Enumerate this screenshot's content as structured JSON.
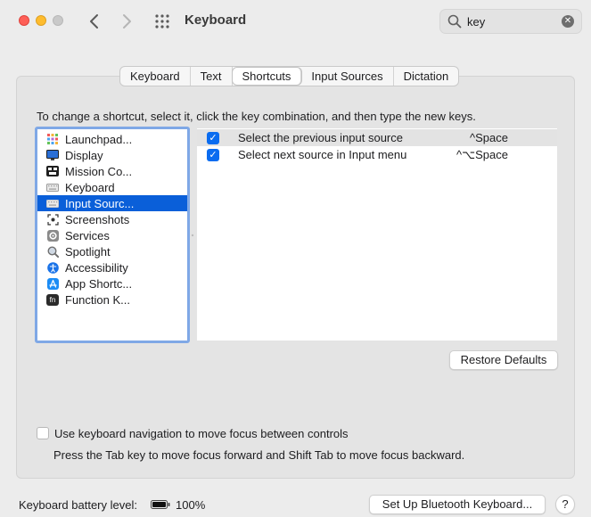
{
  "window": {
    "title": "Keyboard",
    "search_value": "key"
  },
  "tabs": [
    {
      "label": "Keyboard",
      "active": false
    },
    {
      "label": "Text",
      "active": false
    },
    {
      "label": "Shortcuts",
      "active": true
    },
    {
      "label": "Input Sources",
      "active": false
    },
    {
      "label": "Dictation",
      "active": false
    }
  ],
  "instructions": "To change a shortcut, select it, click the key combination, and then type the new keys.",
  "categories": [
    {
      "label": "Launchpad...",
      "icon": "launchpad-icon",
      "selected": false
    },
    {
      "label": "Display",
      "icon": "display-icon",
      "selected": false
    },
    {
      "label": "Mission Co...",
      "icon": "mission-control-icon",
      "selected": false
    },
    {
      "label": "Keyboard",
      "icon": "keyboard-icon",
      "selected": false
    },
    {
      "label": "Input Sourc...",
      "icon": "input-sources-icon",
      "selected": true
    },
    {
      "label": "Screenshots",
      "icon": "screenshots-icon",
      "selected": false
    },
    {
      "label": "Services",
      "icon": "services-gear-icon",
      "selected": false
    },
    {
      "label": "Spotlight",
      "icon": "spotlight-magnifier-icon",
      "selected": false
    },
    {
      "label": "Accessibility",
      "icon": "accessibility-icon",
      "selected": false
    },
    {
      "label": "App Shortc...",
      "icon": "app-store-icon",
      "selected": false
    },
    {
      "label": "Function K...",
      "icon": "fn-key-icon",
      "selected": false
    }
  ],
  "shortcuts": [
    {
      "label": "Select the previous input source",
      "keys": "^Space",
      "checked": true,
      "selected": true
    },
    {
      "label": "Select next source in Input menu",
      "keys": "^⌥Space",
      "checked": true,
      "selected": false
    }
  ],
  "buttons": {
    "restore_defaults": "Restore Defaults",
    "bluetooth": "Set Up Bluetooth Keyboard...",
    "help": "?"
  },
  "keyboard_navigation": {
    "label": "Use keyboard navigation to move focus between controls",
    "checked": false,
    "help": "Press the Tab key to move focus forward and Shift Tab to move focus backward."
  },
  "battery": {
    "label": "Keyboard battery level:",
    "percent_text": "100%",
    "level": 1.0
  },
  "colors": {
    "accent": "#0a5fd9",
    "close": "#fe5f57",
    "minimize": "#febc2e"
  }
}
